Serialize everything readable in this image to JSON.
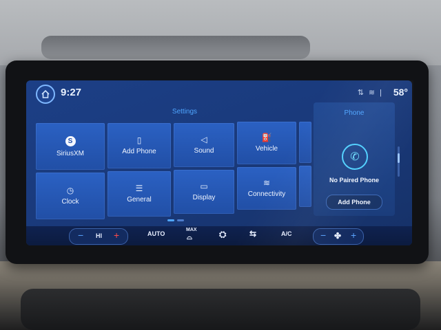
{
  "status": {
    "time": "9:27",
    "temperature": "58°",
    "icons": [
      "phone-signal-icon",
      "wifi-icon"
    ]
  },
  "settings": {
    "title": "Settings",
    "tiles": [
      {
        "label": "SiriusXM",
        "icon": "siriusxm-icon"
      },
      {
        "label": "Add Phone",
        "icon": "add-phone-icon"
      },
      {
        "label": "Sound",
        "icon": "speaker-icon"
      },
      {
        "label": "Vehicle",
        "icon": "vehicle-icon"
      },
      {
        "label": "Clock",
        "icon": "clock-icon"
      },
      {
        "label": "General",
        "icon": "sliders-icon"
      },
      {
        "label": "Display",
        "icon": "display-icon"
      },
      {
        "label": "Connectivity",
        "icon": "wifi-icon"
      }
    ]
  },
  "phone": {
    "title": "Phone",
    "status": "No Paired Phone",
    "button_label": "Add Phone"
  },
  "climate": {
    "fan_speed": "HI",
    "auto_label": "AUTO",
    "max_label": "MAX",
    "ac_label": "A/C",
    "minus": "−",
    "plus": "+"
  },
  "colors": {
    "accent": "#4fa6ff",
    "tile": "#2b61c3",
    "screen_bg": "#1a3a7c",
    "heat": "#ff4a4a"
  }
}
